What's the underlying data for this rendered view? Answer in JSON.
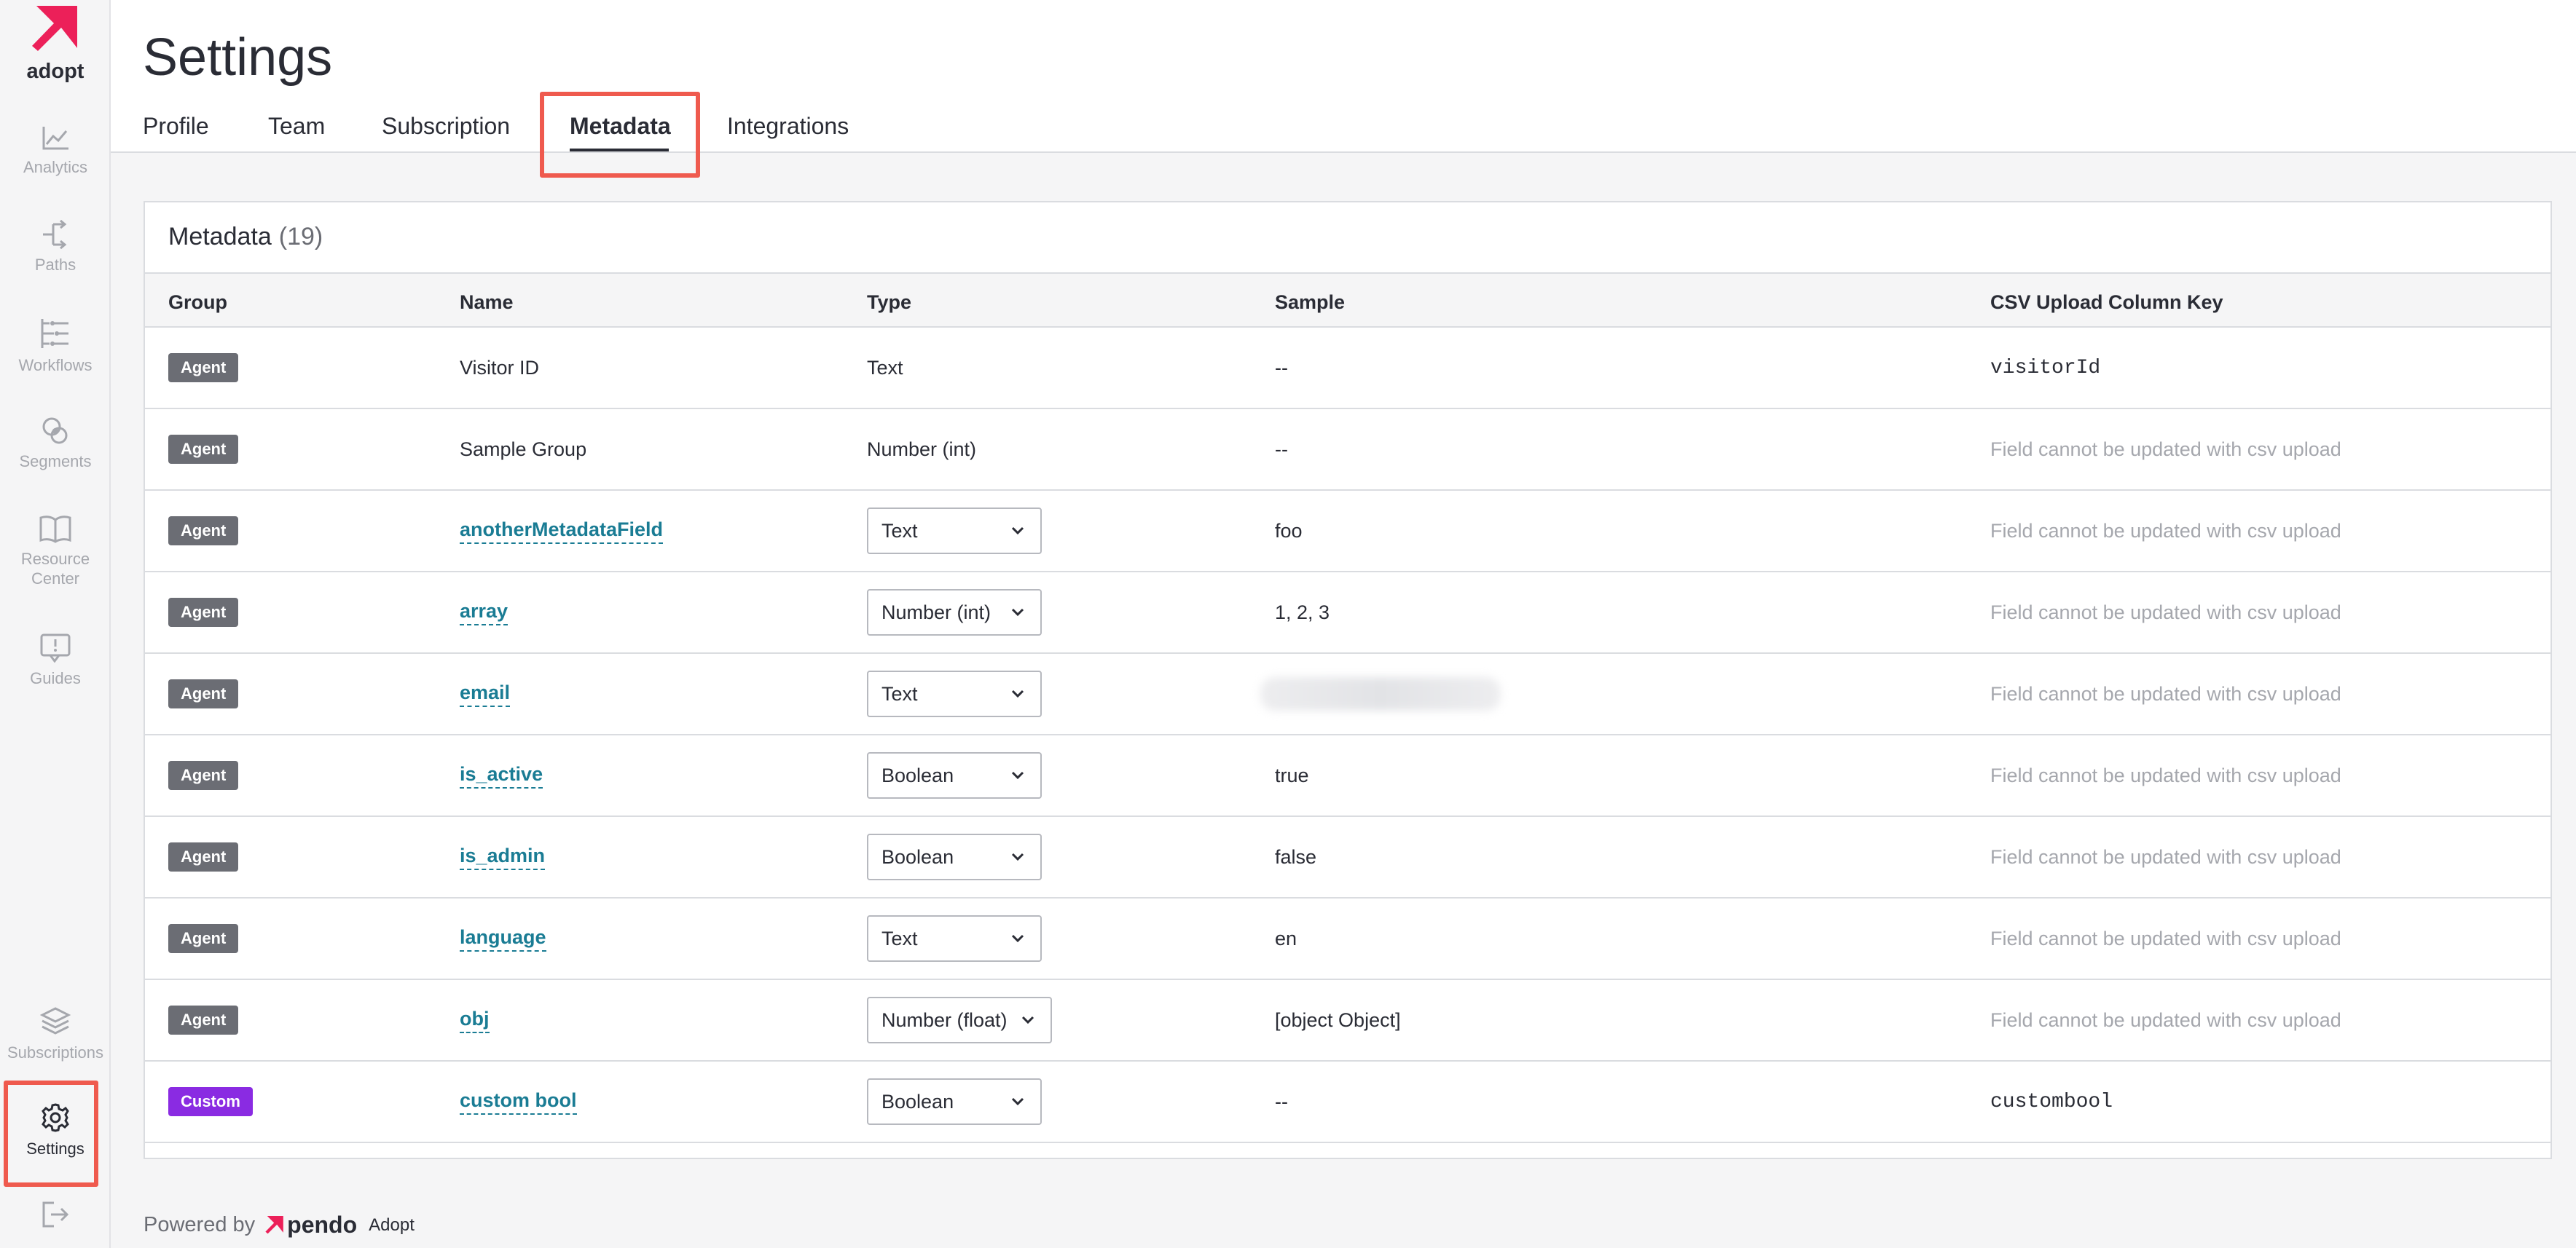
{
  "sidebar": {
    "logo_text": "adopt",
    "items": [
      {
        "label": "Analytics"
      },
      {
        "label": "Paths"
      },
      {
        "label": "Workflows"
      },
      {
        "label": "Segments"
      },
      {
        "label": "Resource Center"
      },
      {
        "label": "Guides"
      },
      {
        "label": "Subscriptions"
      },
      {
        "label": "Settings"
      }
    ]
  },
  "header": {
    "title": "Settings",
    "tabs": [
      {
        "label": "Profile"
      },
      {
        "label": "Team"
      },
      {
        "label": "Subscription"
      },
      {
        "label": "Metadata"
      },
      {
        "label": "Integrations"
      }
    ],
    "active_tab": "Metadata"
  },
  "card": {
    "title": "Metadata",
    "count": "(19)",
    "columns": [
      "Group",
      "Name",
      "Type",
      "Sample",
      "CSV Upload Column Key"
    ],
    "rows": [
      {
        "group": "Agent",
        "name": "Visitor ID",
        "type": "Text",
        "sample": "--",
        "csv": "visitorId"
      },
      {
        "group": "Agent",
        "name": "Sample Group",
        "type": "Number (int)",
        "sample": "--",
        "csv": "Field cannot be updated with csv upload"
      },
      {
        "group": "Agent",
        "name": "anotherMetadataField",
        "type": "Text",
        "sample": "foo",
        "csv": "Field cannot be updated with csv upload"
      },
      {
        "group": "Agent",
        "name": "array",
        "type": "Number (int)",
        "sample": "1, 2, 3",
        "csv": "Field cannot be updated with csv upload"
      },
      {
        "group": "Agent",
        "name": "email",
        "type": "Text",
        "sample": "",
        "csv": "Field cannot be updated with csv upload"
      },
      {
        "group": "Agent",
        "name": "is_active",
        "type": "Boolean",
        "sample": "true",
        "csv": "Field cannot be updated with csv upload"
      },
      {
        "group": "Agent",
        "name": "is_admin",
        "type": "Boolean",
        "sample": "false",
        "csv": "Field cannot be updated with csv upload"
      },
      {
        "group": "Agent",
        "name": "language",
        "type": "Text",
        "sample": "en",
        "csv": "Field cannot be updated with csv upload"
      },
      {
        "group": "Agent",
        "name": "obj",
        "type": "Number (float)",
        "sample": "[object Object]",
        "csv": "Field cannot be updated with csv upload"
      },
      {
        "group": "Custom",
        "name": "custom bool",
        "type": "Boolean",
        "sample": "--",
        "csv": "custombool"
      }
    ]
  },
  "footer": {
    "powered_by": "Powered by",
    "brand": "pendo",
    "product": "Adopt"
  },
  "colors": {
    "accent": "#ef5a4e",
    "brand_pink": "#ec2059",
    "link": "#1a7c94",
    "custom_badge": "#8a2be2",
    "agent_badge": "#6b6d74"
  },
  "icons": [
    "pendo-logo-icon",
    "analytics-icon",
    "paths-icon",
    "workflows-icon",
    "segments-icon",
    "resource-center-icon",
    "guides-icon",
    "subscriptions-icon",
    "gear-icon",
    "logout-icon",
    "chevron-down-icon"
  ]
}
